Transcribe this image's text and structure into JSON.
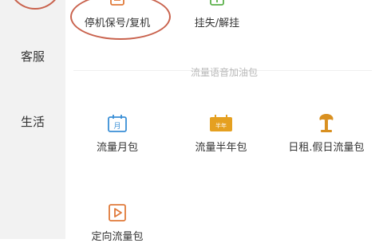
{
  "sidebar": {
    "items": [
      {
        "label": "客服"
      },
      {
        "label": "生活"
      }
    ]
  },
  "top_actions": [
    {
      "label": "停机保号/复机",
      "icon": "sim-card-icon",
      "color": "#e07a3a"
    },
    {
      "label": "挂失/解挂",
      "icon": "report-loss-icon",
      "color": "#5bb04a"
    }
  ],
  "section": {
    "title": "流量语音加油包"
  },
  "packages": [
    {
      "label": "流量月包",
      "icon": "calendar-month-icon",
      "icon_text": "月",
      "color": "#3a8fd6"
    },
    {
      "label": "流量半年包",
      "icon": "calendar-half-year-icon",
      "icon_text": "半年",
      "color": "#e5a020"
    },
    {
      "label": "日租.假日流量包",
      "icon": "holiday-tree-icon",
      "color": "#d99020"
    },
    {
      "label": "定向流量包",
      "icon": "play-video-icon",
      "color": "#e07a3a"
    }
  ]
}
